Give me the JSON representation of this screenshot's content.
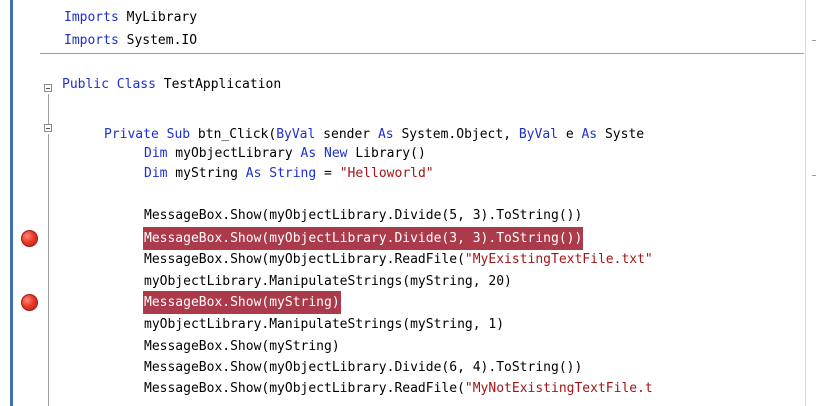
{
  "editor": {
    "colors": {
      "keyword": "#1c2fd0",
      "string": "#a31515",
      "highlight": "#ab3a4a",
      "breakpoint": "#ea3a2a"
    },
    "lines": {
      "l1_kw": "Imports",
      "l1_rest": " MyLibrary",
      "l2_kw": "Imports",
      "l2_rest": " System.IO",
      "l3_kw1": "Public",
      "l3_kw2": "Class",
      "l3_rest": " TestApplication",
      "l4_kw1": "Private",
      "l4_kw2": "Sub",
      "l4_a": " btn_Click(",
      "l4_kw3": "ByVal",
      "l4_b": " sender ",
      "l4_kw4": "As",
      "l4_c": " System.Object, ",
      "l4_kw5": "ByVal",
      "l4_d": " e ",
      "l4_kw6": "As",
      "l4_e": " Syste",
      "l5_kw1": "Dim",
      "l5_a": " myObjectLibrary ",
      "l5_kw2": "As",
      "l5_kw3": "New",
      "l5_b": " Library()",
      "l6_kw1": "Dim",
      "l6_a": " myString ",
      "l6_kw2": "As",
      "l6_kw3": "String",
      "l6_b": " = ",
      "l6_str": "\"Helloworld\"",
      "l7": "MessageBox.Show(myObjectLibrary.Divide(5, 3).ToString())",
      "l8": "MessageBox.Show(myObjectLibrary.Divide(3, 3).ToString())",
      "l9_a": "MessageBox.Show(myObjectLibrary.ReadFile(",
      "l9_str": "\"MyExistingTextFile.txt\"",
      "l10": "myObjectLibrary.ManipulateStrings(myString, 20)",
      "l11": "MessageBox.Show(myString)",
      "l12": "myObjectLibrary.ManipulateStrings(myString, 1)",
      "l13": "MessageBox.Show(myString)",
      "l14": "MessageBox.Show(myObjectLibrary.Divide(6, 4).ToString())",
      "l15_a": "MessageBox.Show(myObjectLibrary.ReadFile(",
      "l15_str": "\"MyNotExistingTextFile.t"
    },
    "breakpoints": [
      "line-8",
      "line-11"
    ]
  }
}
